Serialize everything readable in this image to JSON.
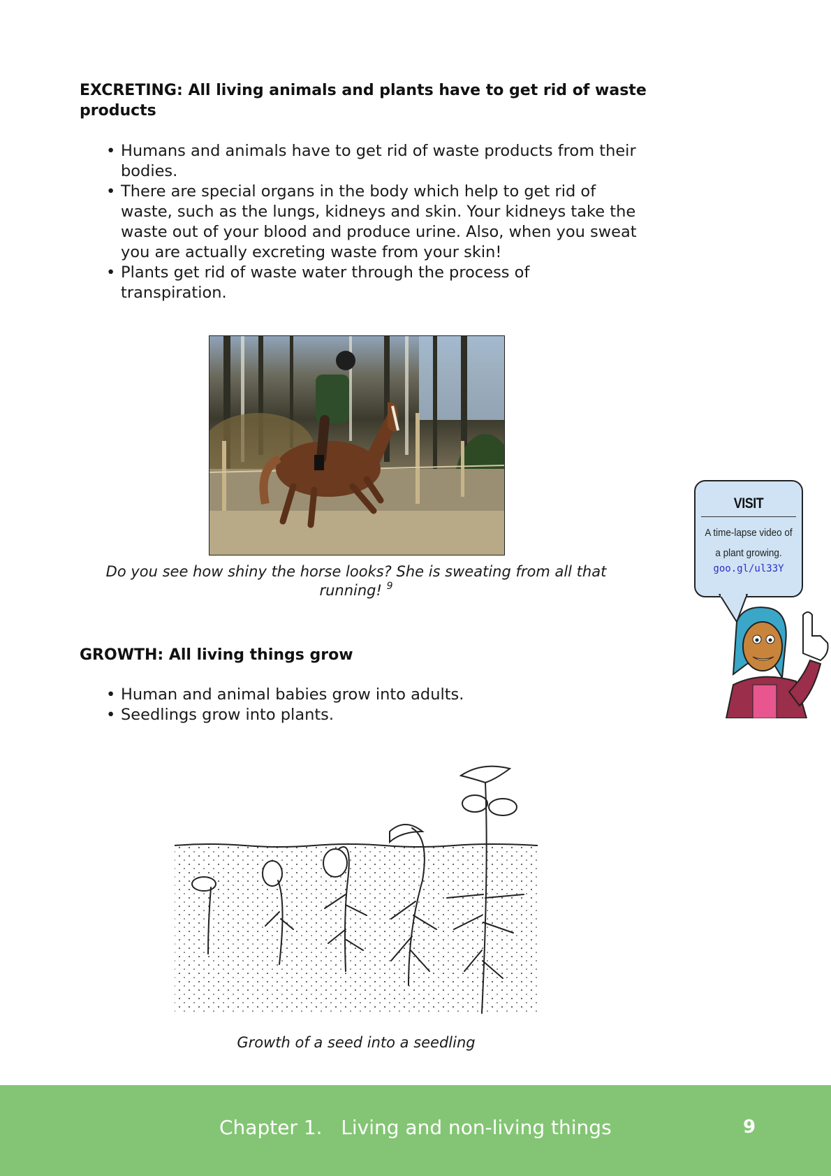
{
  "excreting": {
    "heading": "EXCRETING: All living animals and plants have to get rid of waste products",
    "bullets": [
      "Humans and animals have to get rid of waste products from their bodies.",
      "There are special organs in the body which help to get rid of waste, such as the lungs, kidneys and skin. Your kidneys take the waste out of your blood and produce urine. Also, when you sweat you are actually excreting waste from your skin!",
      "Plants get rid of waste water through the process of transpiration."
    ]
  },
  "horse_figure": {
    "caption": "Do you see how shiny the horse looks? She is sweating from all that running!",
    "footnote": "9"
  },
  "growth": {
    "heading": "GROWTH: All living things grow",
    "bullets": [
      "Human and animal babies grow into adults.",
      "Seedlings grow into plants."
    ]
  },
  "seedling_figure": {
    "caption": "Growth of a seed into a seedling"
  },
  "callout": {
    "title": "VISIT",
    "line1": "A time-lapse video of",
    "line2": "a plant growing.",
    "link": "goo.gl/ul33Y"
  },
  "footer": {
    "chapter": "Chapter 1.   Living and non-living things",
    "page_number": "9"
  },
  "colors": {
    "footer_bg": "#83c574",
    "callout_bg": "#cfe3f4",
    "link": "#2a2ec8"
  }
}
